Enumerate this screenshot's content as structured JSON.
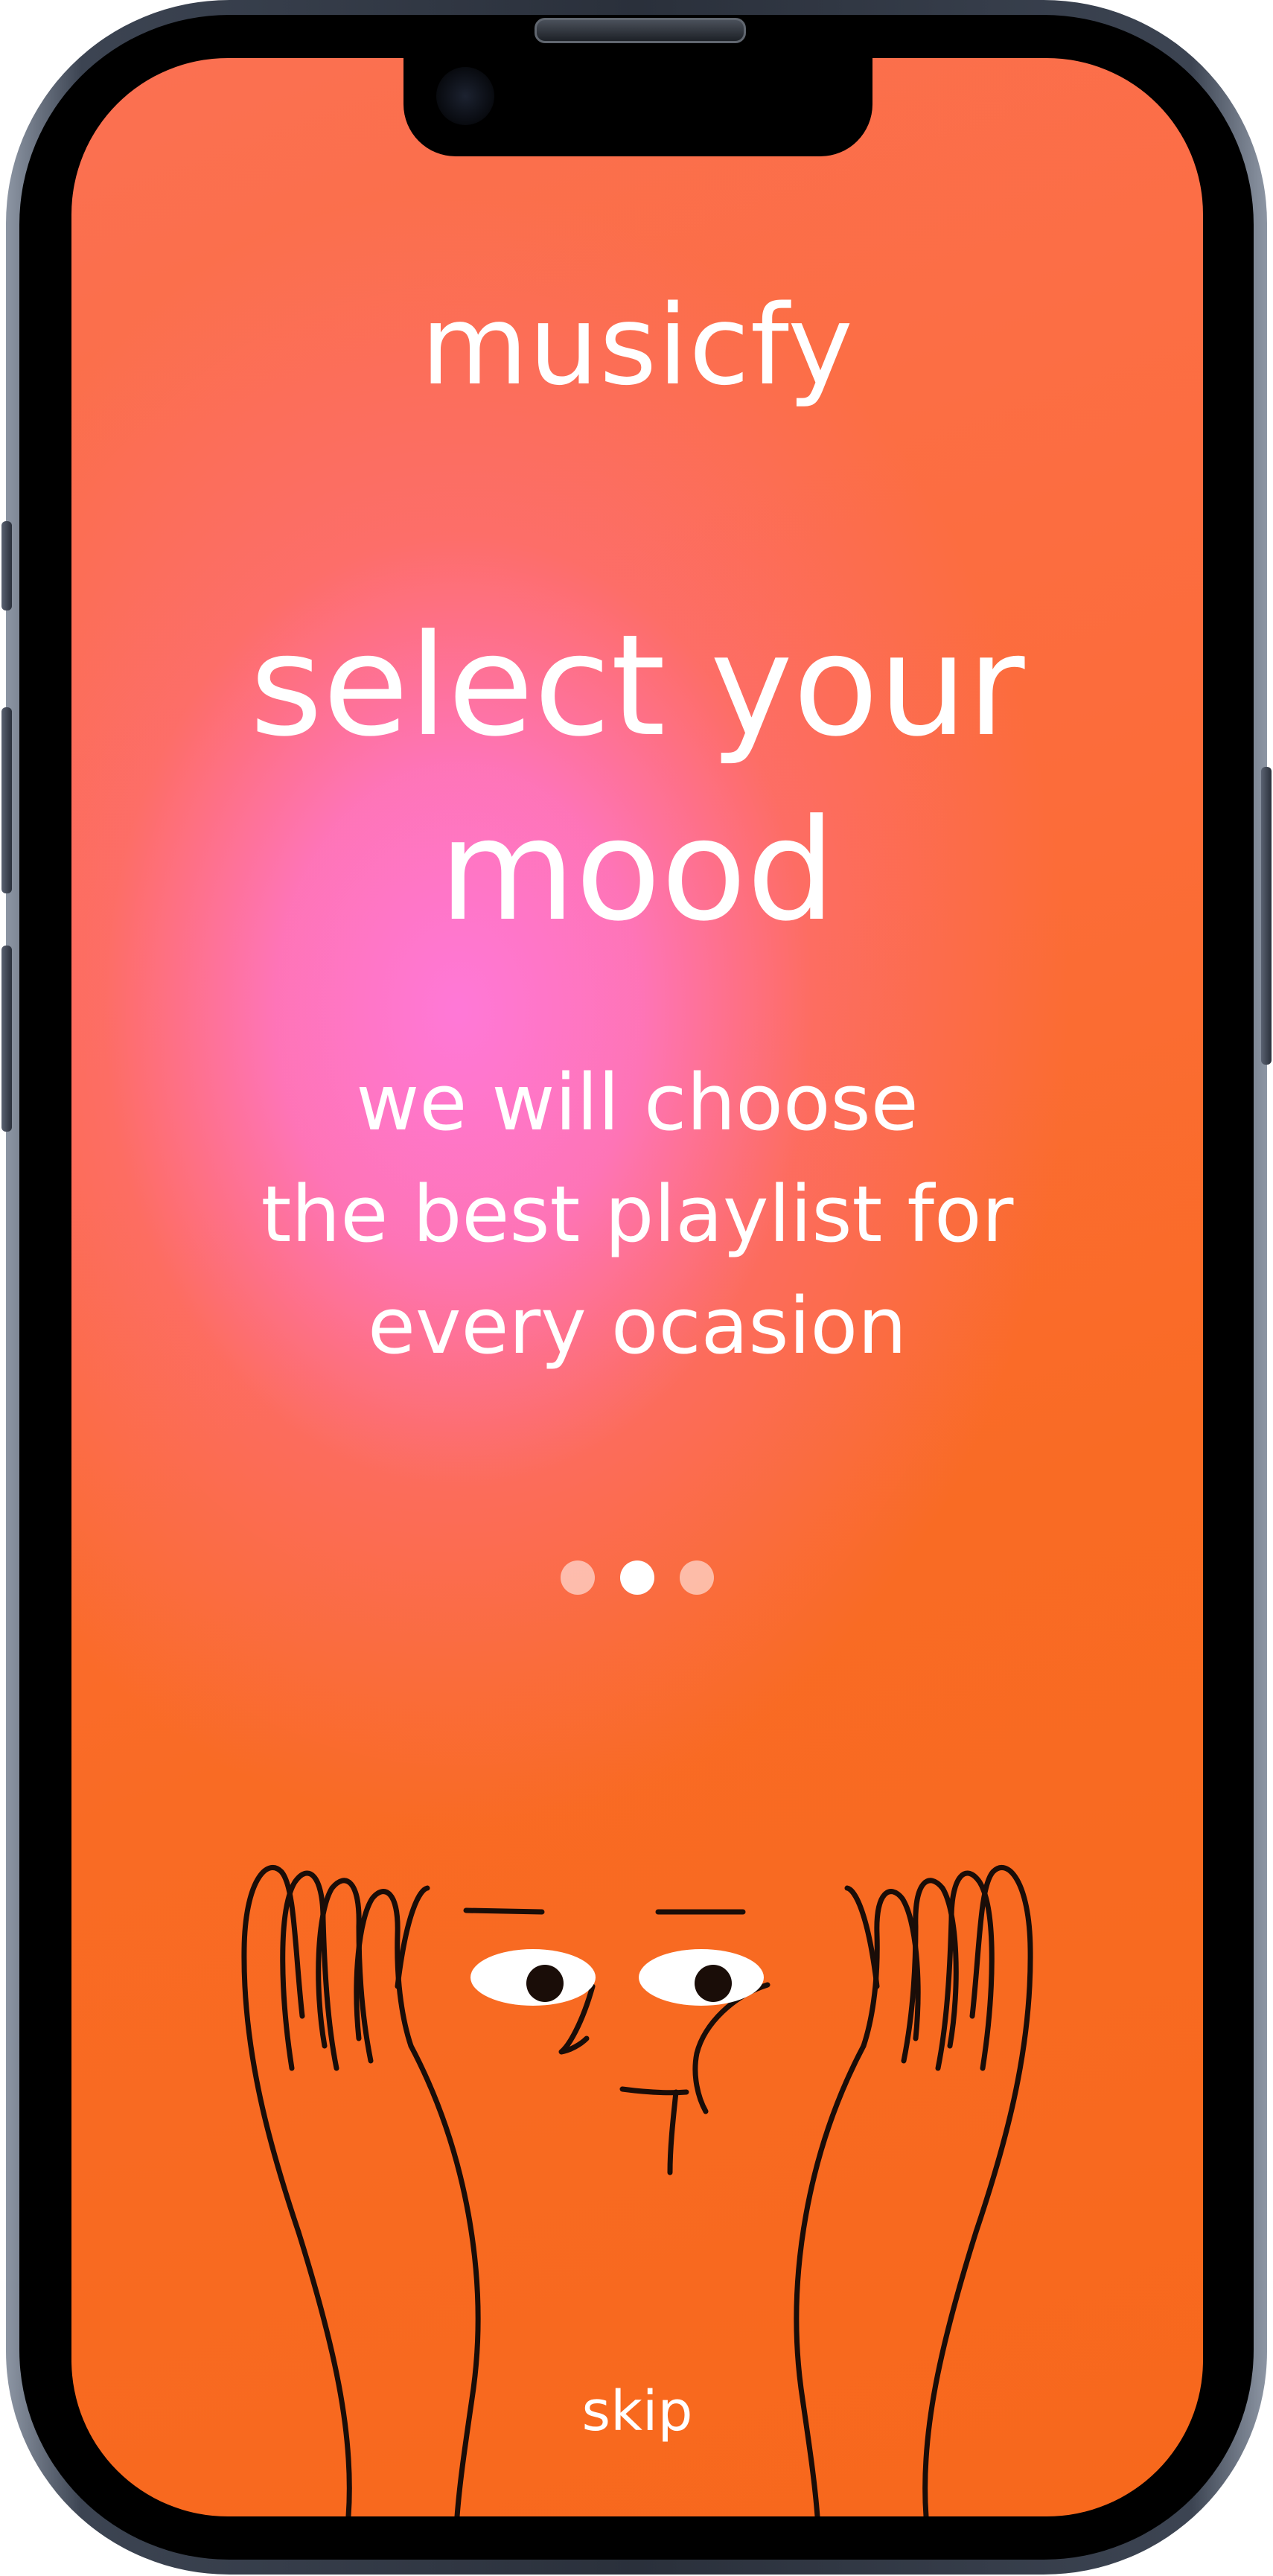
{
  "app": {
    "brand": "musicfy"
  },
  "onboarding": {
    "title_line1": "select your",
    "title_line2": "mood",
    "subtitle_line1": "we will choose",
    "subtitle_line2": "the best playlist for",
    "subtitle_line3": "every ocasion",
    "pagination": {
      "total": 3,
      "active_index": 1
    },
    "skip_label": "skip"
  },
  "colors": {
    "orange": "#f96b24",
    "pink": "#ff78d7",
    "text": "#ffffff",
    "line_art": "#1a0d08"
  },
  "icons": {
    "illustration": "thinking-face-hands-illustration"
  }
}
